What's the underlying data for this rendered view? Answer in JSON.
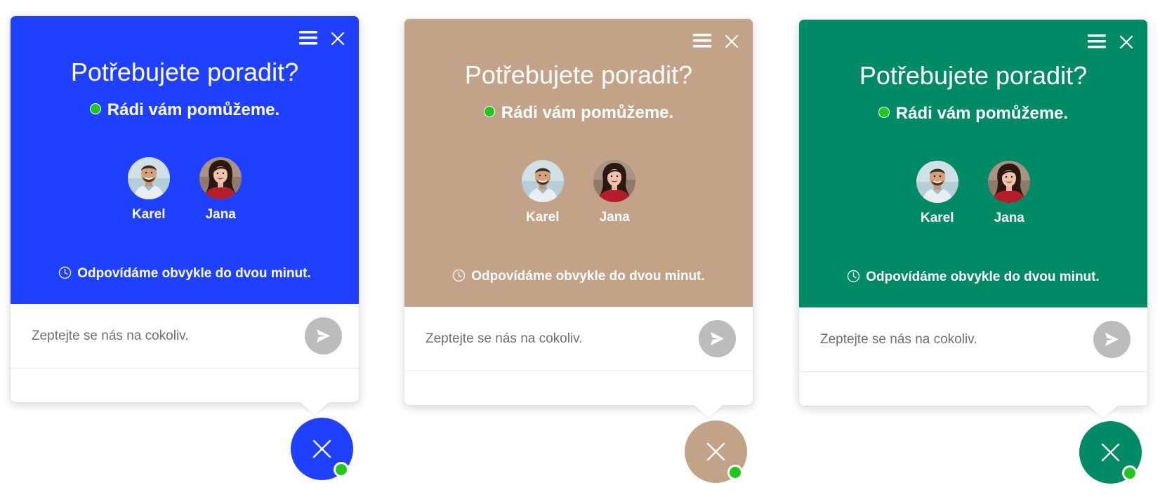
{
  "widgets": [
    {
      "theme_color": "#2040ff",
      "title": "Potřebujete poradit?",
      "status_text": "Rádi vám pomůžeme.",
      "agents": [
        {
          "name": "Karel",
          "avatar_icon": "man-avatar"
        },
        {
          "name": "Jana",
          "avatar_icon": "woman-avatar"
        }
      ],
      "response_text": "Odpovídáme obvykle do dvou minut.",
      "input_placeholder": "Zeptejte se nás na cokoliv."
    },
    {
      "theme_color": "#c3a387",
      "title": "Potřebujete poradit?",
      "status_text": "Rádi vám pomůžeme.",
      "agents": [
        {
          "name": "Karel",
          "avatar_icon": "man-avatar"
        },
        {
          "name": "Jana",
          "avatar_icon": "woman-avatar"
        }
      ],
      "response_text": "Odpovídáme obvykle do dvou minut.",
      "input_placeholder": "Zeptejte se nás na cokoliv."
    },
    {
      "theme_color": "#008a66",
      "title": "Potřebujete poradit?",
      "status_text": "Rádi vám pomůžeme.",
      "agents": [
        {
          "name": "Karel",
          "avatar_icon": "man-avatar"
        },
        {
          "name": "Jana",
          "avatar_icon": "woman-avatar"
        }
      ],
      "response_text": "Odpovídáme obvykle do dvou minut.",
      "input_placeholder": "Zeptejte se nás na cokoliv."
    }
  ],
  "colors": {
    "online": "#22c61c",
    "send_button": "#bcbcbc"
  },
  "icons": [
    "menu-icon",
    "close-icon",
    "status-dot",
    "clock-icon",
    "send-icon",
    "launcher-close-icon"
  ]
}
